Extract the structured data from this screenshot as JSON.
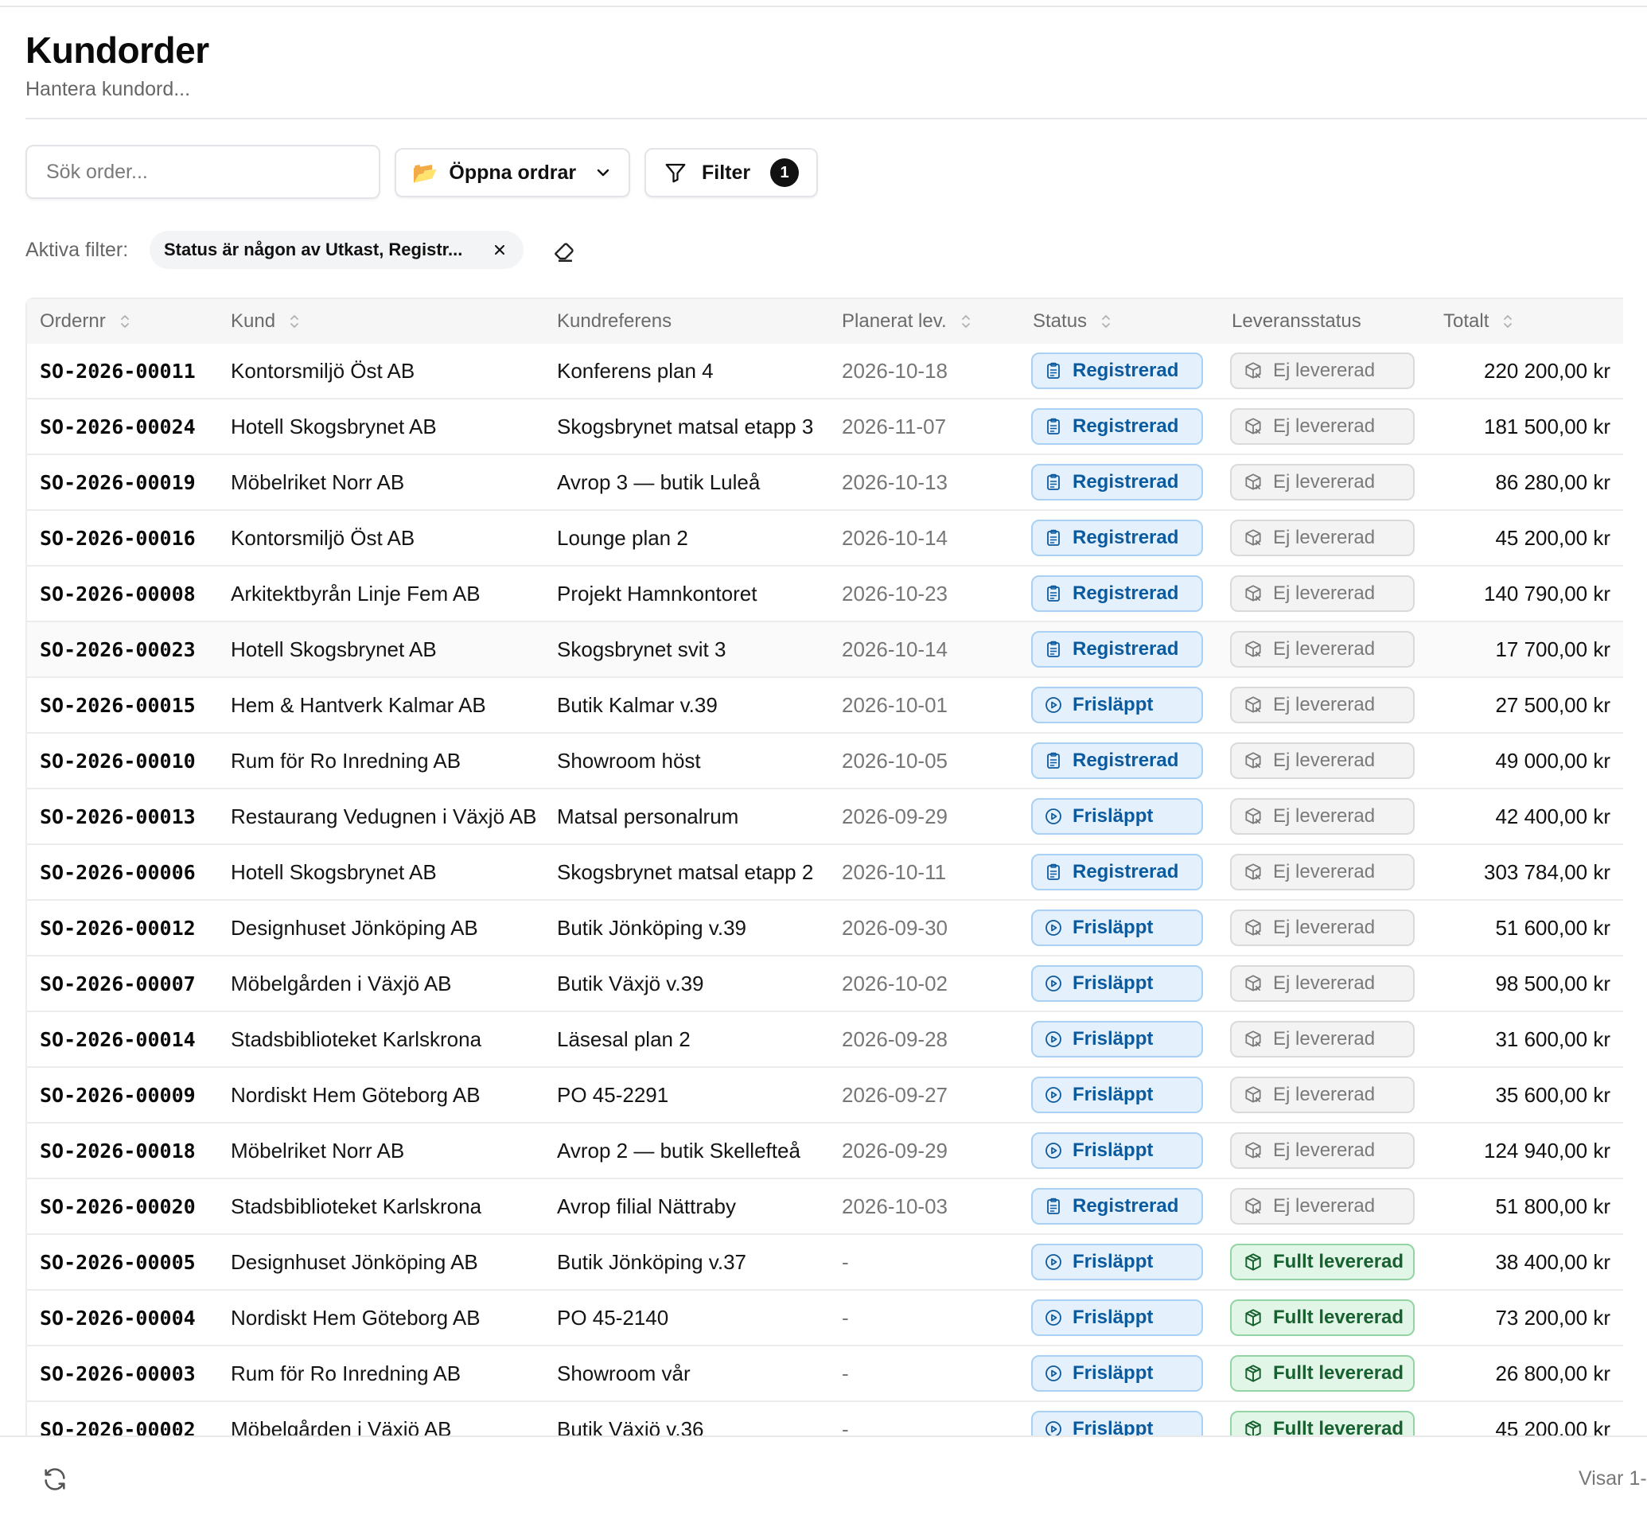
{
  "header": {
    "title": "Kundorder",
    "subtitle": "Hantera kundord..."
  },
  "toolbar": {
    "search_placeholder": "Sök order...",
    "view_label": "Öppna ordrar",
    "view_icon": "folder-icon",
    "filter_label": "Filter",
    "filter_count": "1"
  },
  "active_filters": {
    "label": "Aktiva filter:",
    "chip": "Status är någon av Utkast, Registr..."
  },
  "table": {
    "columns": [
      "Ordernr",
      "Kund",
      "Kundreferens",
      "Planerat lev.",
      "Status",
      "Leveransstatus",
      "Totalt"
    ],
    "rows": [
      {
        "ordernr": "SO-2026-00011",
        "kund": "Kontorsmiljö Öst AB",
        "ref": "Konferens plan 4",
        "date": "2026-10-18",
        "status": "Registrerad",
        "lev": "Ej levererad",
        "total": "220 200,00 kr"
      },
      {
        "ordernr": "SO-2026-00024",
        "kund": "Hotell Skogsbrynet AB",
        "ref": "Skogsbrynet matsal etapp 3",
        "date": "2026-11-07",
        "status": "Registrerad",
        "lev": "Ej levererad",
        "total": "181 500,00 kr"
      },
      {
        "ordernr": "SO-2026-00019",
        "kund": "Möbelriket Norr AB",
        "ref": "Avrop 3 — butik Luleå",
        "date": "2026-10-13",
        "status": "Registrerad",
        "lev": "Ej levererad",
        "total": "86 280,00 kr"
      },
      {
        "ordernr": "SO-2026-00016",
        "kund": "Kontorsmiljö Öst AB",
        "ref": "Lounge plan 2",
        "date": "2026-10-14",
        "status": "Registrerad",
        "lev": "Ej levererad",
        "total": "45 200,00 kr"
      },
      {
        "ordernr": "SO-2026-00008",
        "kund": "Arkitektbyrån Linje Fem AB",
        "ref": "Projekt Hamnkontoret",
        "date": "2026-10-23",
        "status": "Registrerad",
        "lev": "Ej levererad",
        "total": "140 790,00 kr"
      },
      {
        "ordernr": "SO-2026-00023",
        "kund": "Hotell Skogsbrynet AB",
        "ref": "Skogsbrynet svit 3",
        "date": "2026-10-14",
        "status": "Registrerad",
        "lev": "Ej levererad",
        "total": "17 700,00 kr"
      },
      {
        "ordernr": "SO-2026-00015",
        "kund": "Hem & Hantverk Kalmar AB",
        "ref": "Butik Kalmar v.39",
        "date": "2026-10-01",
        "status": "Frisläppt",
        "lev": "Ej levererad",
        "total": "27 500,00 kr"
      },
      {
        "ordernr": "SO-2026-00010",
        "kund": "Rum för Ro Inredning AB",
        "ref": "Showroom höst",
        "date": "2026-10-05",
        "status": "Registrerad",
        "lev": "Ej levererad",
        "total": "49 000,00 kr"
      },
      {
        "ordernr": "SO-2026-00013",
        "kund": "Restaurang Vedugnen i Växjö AB",
        "ref": "Matsal personalrum",
        "date": "2026-09-29",
        "status": "Frisläppt",
        "lev": "Ej levererad",
        "total": "42 400,00 kr"
      },
      {
        "ordernr": "SO-2026-00006",
        "kund": "Hotell Skogsbrynet AB",
        "ref": "Skogsbrynet matsal etapp 2",
        "date": "2026-10-11",
        "status": "Registrerad",
        "lev": "Ej levererad",
        "total": "303 784,00 kr"
      },
      {
        "ordernr": "SO-2026-00012",
        "kund": "Designhuset Jönköping AB",
        "ref": "Butik Jönköping v.39",
        "date": "2026-09-30",
        "status": "Frisläppt",
        "lev": "Ej levererad",
        "total": "51 600,00 kr"
      },
      {
        "ordernr": "SO-2026-00007",
        "kund": "Möbelgården i Växjö AB",
        "ref": "Butik Växjö v.39",
        "date": "2026-10-02",
        "status": "Frisläppt",
        "lev": "Ej levererad",
        "total": "98 500,00 kr"
      },
      {
        "ordernr": "SO-2026-00014",
        "kund": "Stadsbiblioteket Karlskrona",
        "ref": "Läsesal plan 2",
        "date": "2026-09-28",
        "status": "Frisläppt",
        "lev": "Ej levererad",
        "total": "31 600,00 kr"
      },
      {
        "ordernr": "SO-2026-00009",
        "kund": "Nordiskt Hem Göteborg AB",
        "ref": "PO 45-2291",
        "date": "2026-09-27",
        "status": "Frisläppt",
        "lev": "Ej levererad",
        "total": "35 600,00 kr"
      },
      {
        "ordernr": "SO-2026-00018",
        "kund": "Möbelriket Norr AB",
        "ref": "Avrop 2 — butik Skellefteå",
        "date": "2026-09-29",
        "status": "Frisläppt",
        "lev": "Ej levererad",
        "total": "124 940,00 kr"
      },
      {
        "ordernr": "SO-2026-00020",
        "kund": "Stadsbiblioteket Karlskrona",
        "ref": "Avrop filial Nättraby",
        "date": "2026-10-03",
        "status": "Registrerad",
        "lev": "Ej levererad",
        "total": "51 800,00 kr"
      },
      {
        "ordernr": "SO-2026-00005",
        "kund": "Designhuset Jönköping AB",
        "ref": "Butik Jönköping v.37",
        "date": "-",
        "status": "Frisläppt",
        "lev": "Fullt levererad",
        "total": "38 400,00 kr"
      },
      {
        "ordernr": "SO-2026-00004",
        "kund": "Nordiskt Hem Göteborg AB",
        "ref": "PO 45-2140",
        "date": "-",
        "status": "Frisläppt",
        "lev": "Fullt levererad",
        "total": "73 200,00 kr"
      },
      {
        "ordernr": "SO-2026-00003",
        "kund": "Rum för Ro Inredning AB",
        "ref": "Showroom vår",
        "date": "-",
        "status": "Frisläppt",
        "lev": "Fullt levererad",
        "total": "26 800,00 kr"
      },
      {
        "ordernr": "SO-2026-00002",
        "kund": "Möbelgården i Växjö AB",
        "ref": "Butik Växjö v.36",
        "date": "-",
        "status": "Frisläppt",
        "lev": "Fullt levererad",
        "total": "45 200,00 kr"
      }
    ]
  },
  "footer": {
    "showing": "Visar 1-"
  },
  "colors": {
    "registrerad": "#0c5a9e",
    "frislappt": "#0c5a9e",
    "ej_levererad": "#7a7a7a",
    "fullt_levererad": "#17602f"
  }
}
